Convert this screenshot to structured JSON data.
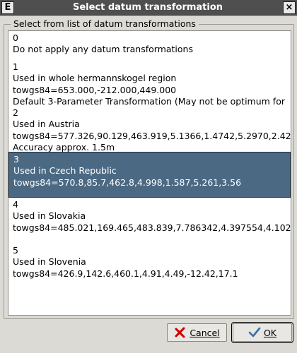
{
  "window": {
    "app_icon": "E",
    "title": "Select datum transformation",
    "close_label": "×"
  },
  "group": {
    "label": "Select from list of datum transformations"
  },
  "items": [
    {
      "lines": [
        "0",
        "Do not apply any datum transformations"
      ],
      "selected": false
    },
    {
      "lines": [
        "1",
        "Used in whole hermannskogel region",
        "towgs84=653.000,-212.000,449.000",
        "Default 3-Parameter Transformation (May not be optimum for"
      ],
      "selected": false
    },
    {
      "lines": [
        "2",
        "Used in Austria",
        "towgs84=577.326,90.129,463.919,5.1366,1.4742,5.2970,2.42",
        "Accuracy approx. 1.5m"
      ],
      "selected": false
    },
    {
      "lines": [
        "3",
        "Used in Czech Republic",
        "towgs84=570.8,85.7,462.8,4.998,1.587,5.261,3.56"
      ],
      "selected": true
    },
    {
      "lines": [
        "4",
        "Used in Slovakia",
        "towgs84=485.021,169.465,483.839,7.786342,4.397554,4.102"
      ],
      "selected": false
    },
    {
      "lines": [
        "5",
        "Used in Slovenia",
        "towgs84=426.9,142.6,460.1,4.91,4.49,-12.42,17.1"
      ],
      "selected": false
    }
  ],
  "buttons": {
    "cancel": {
      "label": "Cancel",
      "icon": "cancel-x-icon",
      "color": "#cc0000"
    },
    "ok": {
      "label": "OK",
      "icon": "ok-check-icon",
      "color": "#3a6ea5"
    }
  },
  "colors": {
    "selection": "#4b6983",
    "titlebar": "#4f4f4f",
    "dialog_bg": "#dcdad5"
  }
}
